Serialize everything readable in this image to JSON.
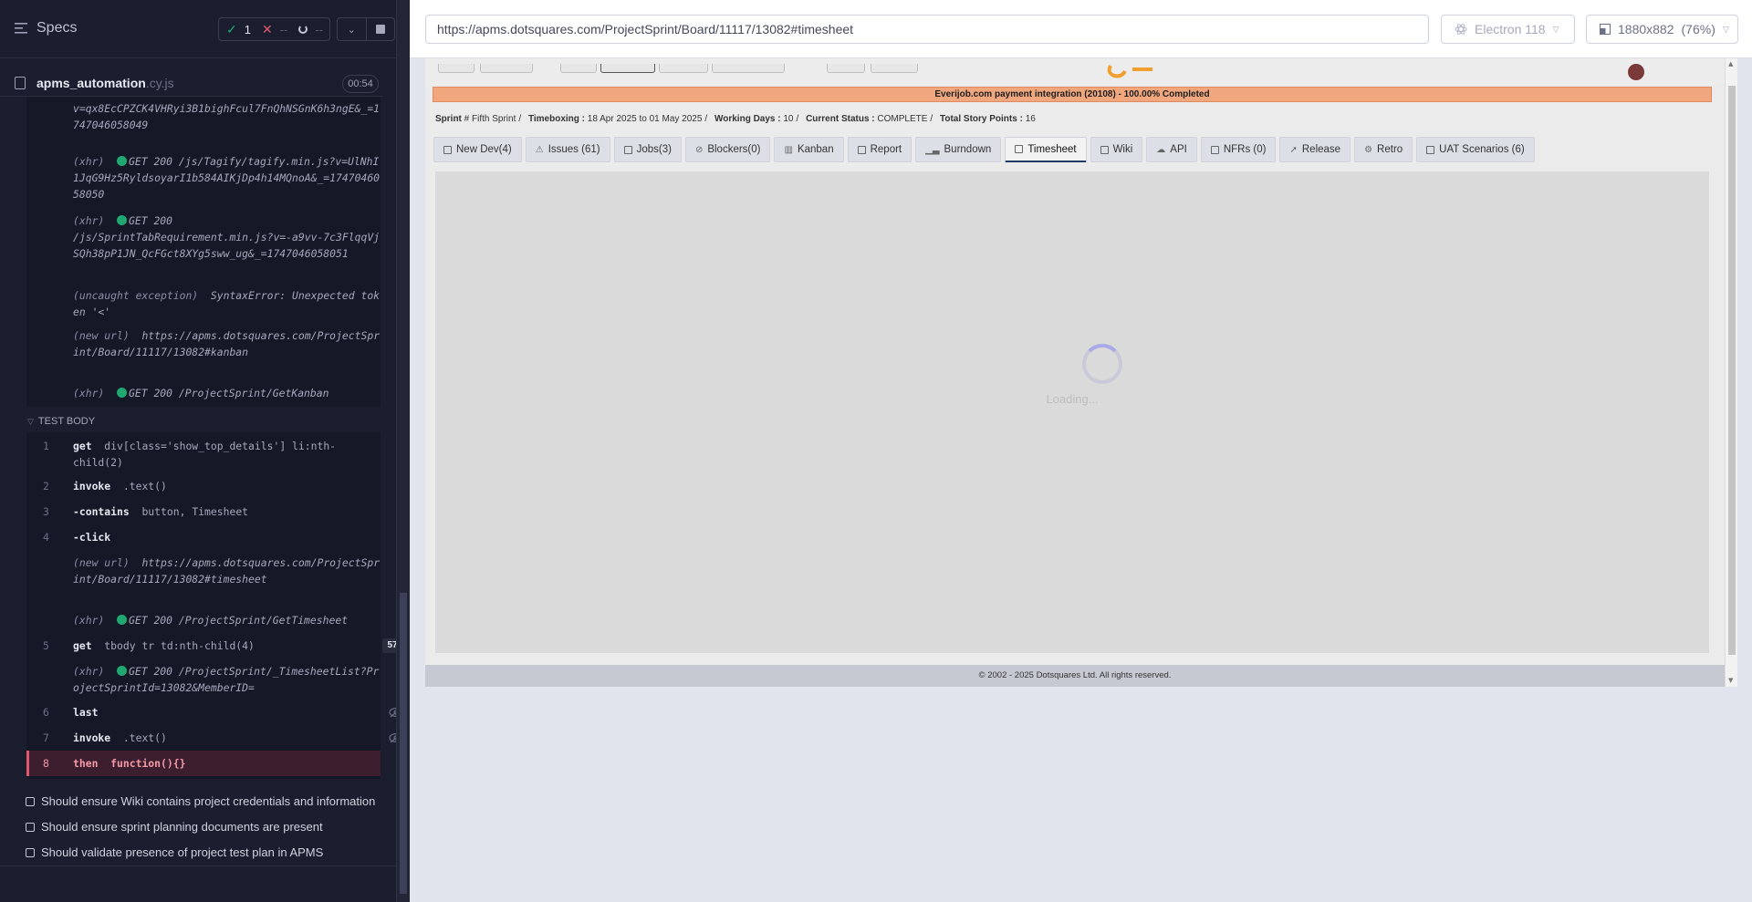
{
  "reporter": {
    "header": {
      "title": "Specs"
    },
    "stats": {
      "passed": "1",
      "failed": "--",
      "pending": "--"
    },
    "spec": {
      "file": "apms_automation",
      "ext": ".cy.js",
      "duration": "00:54"
    },
    "prior_logs": [
      {
        "text": "v=qx8EcCPZCK4VHRyi3B1bighFcul7FnQhNSGnK6h3ngE&_=1747046058049"
      },
      {
        "prefix": "(xhr)",
        "method": "GET 200",
        "url": "/js/Tagify/tagify.min.js?v=UlNhI1JqG9Hz5RyldsoyarI1b584AIKjDp4h14MQnoA&_=1747046058050"
      },
      {
        "prefix": "(xhr)",
        "method": "GET 200",
        "url": "/js/SprintTabRequirement.min.js?v=-a9vv-7c3FlqqVjSQh38pP1JN_QcFGct8XYg5sww_ug&_=1747046058051"
      },
      {
        "prefix": "(uncaught exception)",
        "text": "SyntaxError: Unexpected token '<'"
      },
      {
        "prefix": "(new url)",
        "url": "https://apms.dotsquares.com/ProjectSprint/Board/11117/13082#kanban"
      },
      {
        "prefix": "(xhr)",
        "method": "GET 200",
        "url": "/ProjectSprint/GetKanban"
      }
    ],
    "test_body_label": "TEST BODY",
    "commands": [
      {
        "num": "1",
        "name": "get",
        "arg": "div[class='show_top_details'] li:nth-child(2)"
      },
      {
        "num": "2",
        "name": "invoke",
        "arg": ".text()"
      },
      {
        "num": "3",
        "name": "-contains",
        "arg": "button, Timesheet"
      },
      {
        "num": "4",
        "name": "-click",
        "arg": ""
      },
      {
        "prefix": "(new url)",
        "url": "https://apms.dotsquares.com/ProjectSprint/Board/11117/13082#timesheet"
      },
      {
        "prefix": "(xhr)",
        "method": "GET 200",
        "url": "/ProjectSprint/GetTimesheet"
      },
      {
        "num": "5",
        "name": "get",
        "arg": "tbody tr td:nth-child(4)",
        "badge": "57"
      },
      {
        "prefix": "(xhr)",
        "method": "GET 200",
        "url": "/ProjectSprint/_TimesheetList?ProjectSprintId=13082&MemberID="
      },
      {
        "num": "6",
        "name": "last",
        "arg": ""
      },
      {
        "num": "7",
        "name": "invoke",
        "arg": ".text()"
      },
      {
        "num": "8",
        "name": "then",
        "arg": "function(){}"
      }
    ],
    "tests": [
      "Should ensure Wiki contains project credentials and information",
      "Should ensure sprint planning documents are present",
      "Should validate presence of project test plan in APMS"
    ]
  },
  "toolbar": {
    "url": "https://apms.dotsquares.com/ProjectSprint/Board/11117/13082#timesheet",
    "browser": "Electron 118",
    "viewport": "1880x882",
    "zoom": "(76%)"
  },
  "aut": {
    "banner": "Everijob.com payment integration (20108) - 100.00% Completed",
    "sprint_info": {
      "sprint_label": "Sprint",
      "sprint_value": "# Fifth Sprint",
      "timeboxing_label": "Timeboxing :",
      "timeboxing_value": "18 Apr 2025 to 01 May 2025",
      "working_days_label": "Working Days :",
      "working_days_value": "10",
      "status_label": "Current Status :",
      "status_value": "COMPLETE",
      "points_label": "Total Story Points :",
      "points_value": "16"
    },
    "tabs": [
      {
        "label": "New Dev(4)"
      },
      {
        "label": "Issues (61)"
      },
      {
        "label": "Jobs(3)"
      },
      {
        "label": "Blockers(0)"
      },
      {
        "label": "Kanban"
      },
      {
        "label": "Report"
      },
      {
        "label": "Burndown"
      },
      {
        "label": "Timesheet",
        "active": true
      },
      {
        "label": "Wiki"
      },
      {
        "label": "API"
      },
      {
        "label": "NFRs (0)"
      },
      {
        "label": "Release"
      },
      {
        "label": "Retro"
      },
      {
        "label": "UAT Scenarios (6)"
      }
    ],
    "loading": "Loading...",
    "footer": "© 2002 - 2025 Dotsquares Ltd. All rights reserved."
  }
}
